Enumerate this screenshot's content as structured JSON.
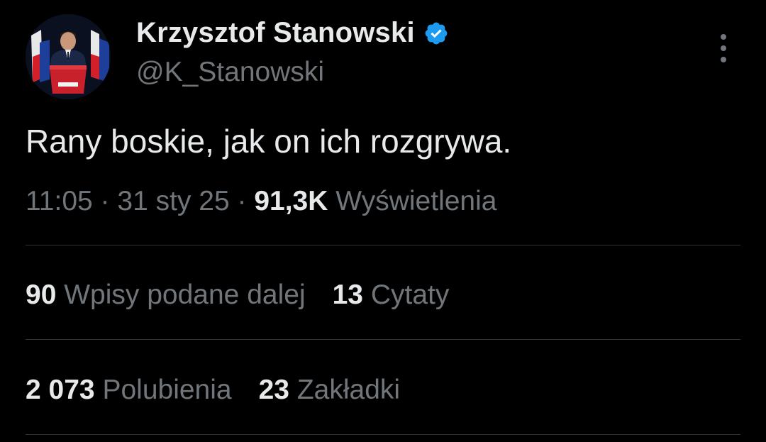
{
  "author": {
    "display_name": "Krzysztof Stanowski",
    "handle": "@K_Stanowski",
    "verified": true,
    "avatar_icon": "profile-photo"
  },
  "tweet": {
    "text": "Rany boskie, jak on ich rozgrywa.",
    "time": "11:05",
    "date": "31 sty 25",
    "views_count": "91,3K",
    "views_label": "Wyświetlenia"
  },
  "stats": {
    "retweets": {
      "count": "90",
      "label": "Wpisy podane dalej"
    },
    "quotes": {
      "count": "13",
      "label": "Cytaty"
    },
    "likes": {
      "count": "2 073",
      "label": "Polubienia"
    },
    "bookmarks": {
      "count": "23",
      "label": "Zakładki"
    }
  },
  "colors": {
    "background": "#000000",
    "primary_text": "#e7e9ea",
    "secondary_text": "#71767b",
    "divider": "#2f3336",
    "verified_blue": "#1d9bf0"
  },
  "icons": {
    "verified": "verified-badge-icon",
    "more": "more-options-icon"
  }
}
